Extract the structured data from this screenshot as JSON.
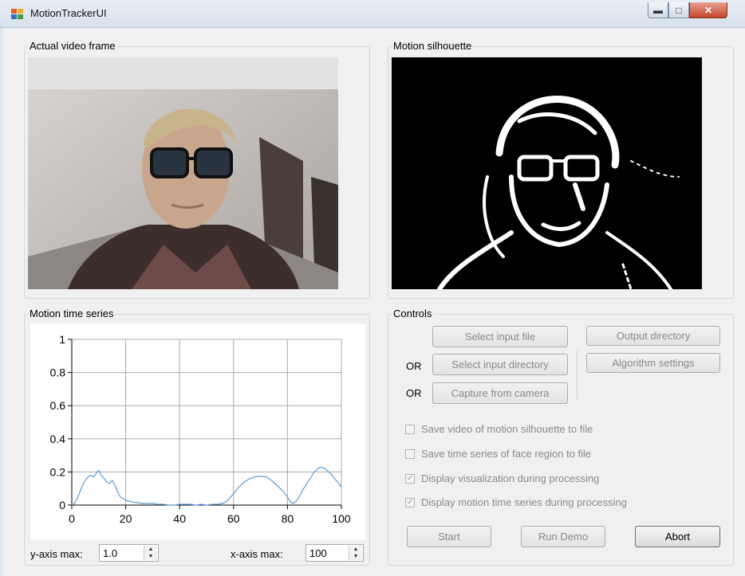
{
  "window": {
    "title": "MotionTrackerUI"
  },
  "groups": {
    "video": "Actual video frame",
    "silhouette": "Motion silhouette",
    "timeseries": "Motion time series",
    "controls": "Controls"
  },
  "controls": {
    "select_input_file": "Select input file",
    "output_directory": "Output directory",
    "or1": "OR",
    "select_input_directory": "Select input directory",
    "algorithm_settings": "Algorithm settings",
    "or2": "OR",
    "capture_from_camera": "Capture from camera",
    "options": [
      {
        "label": "Save video of motion silhouette to file",
        "checked": false
      },
      {
        "label": "Save time series of face region to file",
        "checked": false
      },
      {
        "label": "Display visualization during processing",
        "checked": true
      },
      {
        "label": "Display motion time series during processing",
        "checked": true
      }
    ],
    "start": "Start",
    "run_demo": "Run Demo",
    "abort": "Abort"
  },
  "axes_inputs": {
    "y_label": "y-axis max:",
    "y_value": "1.0",
    "x_label": "x-axis max:",
    "x_value": "100"
  },
  "chart_data": {
    "type": "line",
    "title": "",
    "xlabel": "",
    "ylabel": "",
    "xlim": [
      0,
      100
    ],
    "ylim": [
      0,
      1
    ],
    "x_ticks": [
      0,
      20,
      40,
      60,
      80,
      100
    ],
    "y_ticks": [
      0,
      0.2,
      0.4,
      0.6,
      0.8,
      1
    ],
    "grid": true,
    "series": [
      {
        "color": "#5b9bd5",
        "x": [
          0,
          1,
          2,
          3,
          4,
          5,
          6,
          7,
          8,
          9,
          10,
          11,
          12,
          13,
          14,
          15,
          16,
          17,
          18,
          19,
          20,
          22,
          24,
          26,
          28,
          30,
          32,
          34,
          36,
          38,
          40,
          42,
          44,
          46,
          48,
          50,
          52,
          54,
          56,
          58,
          60,
          62,
          64,
          66,
          68,
          70,
          72,
          74,
          76,
          78,
          80,
          81,
          82,
          83,
          84,
          85,
          86,
          88,
          90,
          92,
          94,
          96,
          98,
          100
        ],
        "y": [
          0,
          0.01,
          0.04,
          0.08,
          0.12,
          0.15,
          0.17,
          0.18,
          0.17,
          0.19,
          0.21,
          0.18,
          0.16,
          0.14,
          0.13,
          0.15,
          0.12,
          0.08,
          0.05,
          0.04,
          0.03,
          0.02,
          0.015,
          0.01,
          0.01,
          0.01,
          0.005,
          0.005,
          0.0,
          0.0,
          0.005,
          0.005,
          0.005,
          0.0,
          0.005,
          0.0,
          0.005,
          0.005,
          0.01,
          0.03,
          0.07,
          0.11,
          0.14,
          0.16,
          0.17,
          0.175,
          0.17,
          0.15,
          0.12,
          0.09,
          0.05,
          0.02,
          0.01,
          0.02,
          0.04,
          0.07,
          0.1,
          0.15,
          0.2,
          0.23,
          0.22,
          0.19,
          0.15,
          0.11
        ]
      }
    ]
  }
}
